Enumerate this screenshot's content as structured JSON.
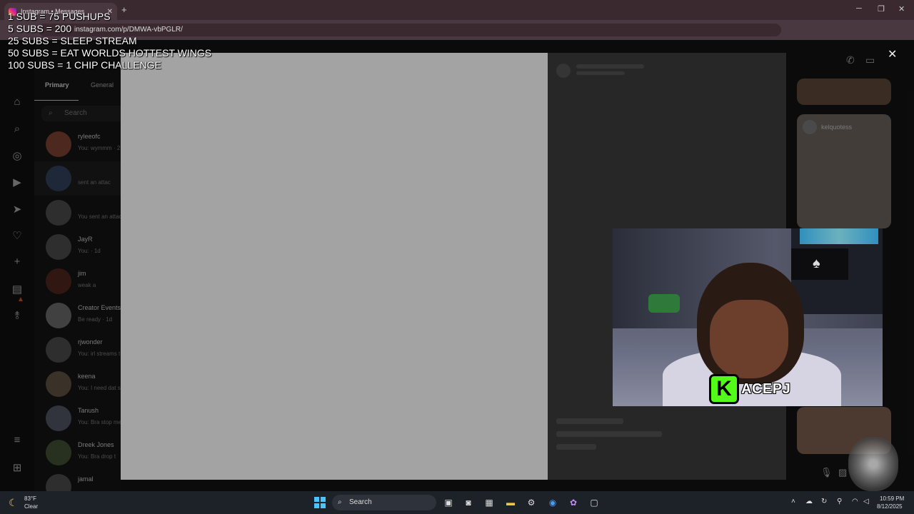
{
  "browser": {
    "tab_title": "Instagram • Messages",
    "new_tab": "+",
    "url": "instagram.com/p/DMWA-vbPGLR/",
    "profile_initials": "PJ"
  },
  "stream_goals": [
    "1 SUB = 75 PUSHUPS",
    "5 SUBS = 200",
    "25 SUBS = SLEEP STREAM",
    "50 SUBS = EAT WORLDS HOTTEST WINGS",
    "100 SUBS = 1 CHIP CHALLENGE"
  ],
  "dm": {
    "tabs": [
      "Primary",
      "General"
    ],
    "search_placeholder": "Search",
    "conversations": [
      {
        "name": "ryleeofc",
        "preview": "You: wymmm · 2",
        "color": "#8a4a3a"
      },
      {
        "name": "",
        "preview": "sent an attac",
        "color": "#3a4a66"
      },
      {
        "name": "",
        "preview": "You sent an attac",
        "color": "#555"
      },
      {
        "name": "JayR",
        "preview": "You: · 1d",
        "color": "#555"
      },
      {
        "name": "jim",
        "preview": "weak a",
        "color": "#5a2a20"
      },
      {
        "name": "Creator Events",
        "preview": "Be ready · 1d",
        "color": "#777"
      },
      {
        "name": "rjwonder",
        "preview": "You: irl streams t",
        "color": "#555"
      },
      {
        "name": "keena",
        "preview": "You: I need dat s",
        "color": "#6a5a4a"
      },
      {
        "name": "Tanush",
        "preview": "You: Bra stop me",
        "color": "#5a6070"
      },
      {
        "name": "Dreek Jones",
        "preview": "You: Bra drop t",
        "color": "#4a5a3a"
      },
      {
        "name": "jamal",
        "preview": "",
        "color": "#555"
      }
    ]
  },
  "right_column": {
    "card_user": "kelquotess"
  },
  "webcam": {
    "brand_letter": "K",
    "streamer_name": "ACEPJ"
  },
  "taskbar": {
    "temperature": "83°F",
    "condition": "Clear",
    "search_label": "Search",
    "time": "10:59 PM",
    "date": "8/12/2025"
  },
  "colors": {
    "kick_green": "#53fc18",
    "modal_media": "#a3a3a3",
    "taskbar": "#1d2128"
  }
}
